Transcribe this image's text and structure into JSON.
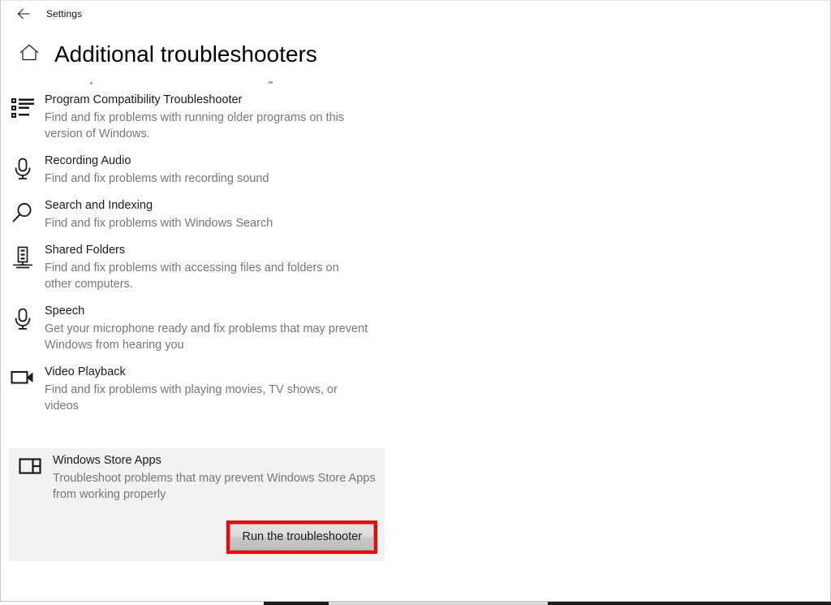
{
  "window": {
    "title_bar_label": "Settings",
    "back_icon": "back-arrow-icon",
    "home_icon": "home-icon"
  },
  "page": {
    "title": "Additional troubleshooters"
  },
  "troubleshooters": [
    {
      "icon": "list-icon",
      "title": "Program Compatibility Troubleshooter",
      "description": "Find and fix problems with running older programs on this version of Windows.",
      "selected": false
    },
    {
      "icon": "microphone-icon",
      "title": "Recording Audio",
      "description": "Find and fix problems with recording sound",
      "selected": false
    },
    {
      "icon": "search-icon",
      "title": "Search and Indexing",
      "description": "Find and fix problems with Windows Search",
      "selected": false
    },
    {
      "icon": "server-icon",
      "title": "Shared Folders",
      "description": "Find and fix problems with accessing files and folders on other computers.",
      "selected": false
    },
    {
      "icon": "microphone-icon",
      "title": "Speech",
      "description": "Get your microphone ready and fix problems that may prevent Windows from hearing you",
      "selected": false
    },
    {
      "icon": "video-camera-icon",
      "title": "Video Playback",
      "description": "Find and fix problems with playing movies, TV shows, or videos",
      "selected": false
    }
  ],
  "selected_item": {
    "icon": "store-apps-icon",
    "title": "Windows Store Apps",
    "description": "Troubleshoot problems that may prevent Windows Store Apps from working properly",
    "run_button_label": "Run the troubleshooter"
  },
  "colors": {
    "highlight_rect": "#fb0007",
    "selected_row_background": "#f2f2f2",
    "title_text": "#000000",
    "description_text": "#767676"
  }
}
